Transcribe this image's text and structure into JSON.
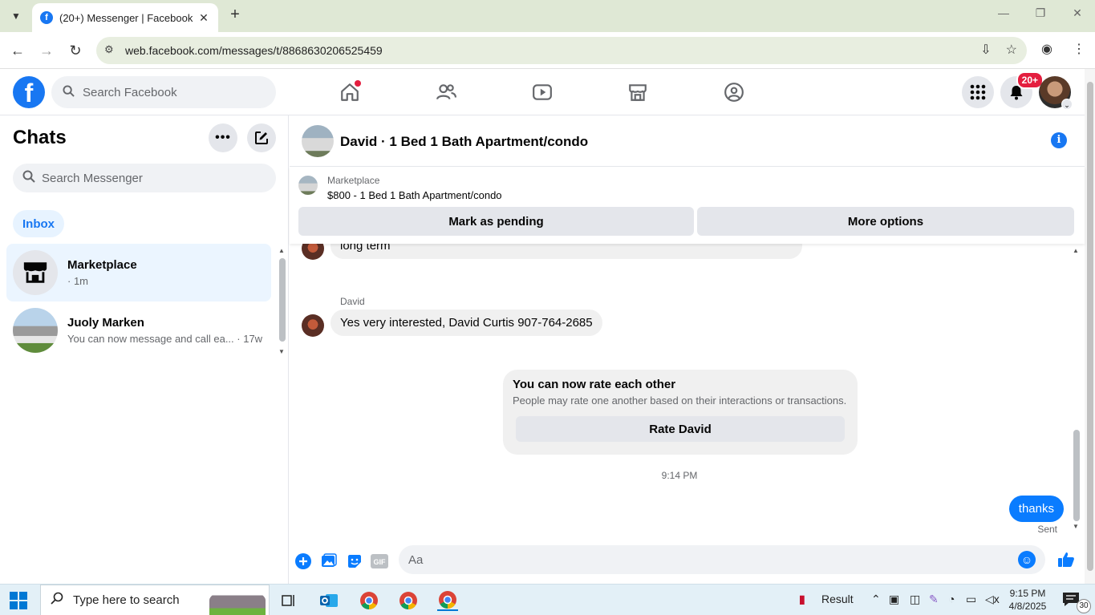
{
  "browser": {
    "tab_title": "(20+) Messenger | Facebook",
    "url": "web.facebook.com/messages/t/8868630206525459"
  },
  "fb_nav": {
    "search_placeholder": "Search Facebook",
    "notification_badge": "20+"
  },
  "chats": {
    "title": "Chats",
    "search_placeholder": "Search Messenger",
    "filter": "Inbox",
    "items": [
      {
        "name": "Marketplace",
        "preview": "· 1m"
      },
      {
        "name": "Juoly Marken",
        "preview": "You can now message and call ea... · 17w"
      }
    ]
  },
  "conversation": {
    "title": "David · 1 Bed 1 Bath Apartment/condo",
    "marketplace_label": "Marketplace",
    "listing": "$800 - 1 Bed 1 Bath Apartment/condo",
    "mark_pending": "Mark as pending",
    "more_options": "More options",
    "messages": {
      "prev_partial": "long term",
      "sender": "David",
      "incoming": "Yes very interested, David Curtis 907-764-2685",
      "rate_title": "You can now rate each other",
      "rate_sub": "People may rate one another based on their interactions or transactions.",
      "rate_button": "Rate David",
      "time": "9:14 PM",
      "outgoing": "thanks",
      "status": "Sent"
    },
    "composer_placeholder": "Aa"
  },
  "taskbar": {
    "search_text": "Type here to search",
    "result_label": "Result",
    "time": "9:15 PM",
    "date": "4/8/2025",
    "notification_count": "30"
  },
  "colors": {
    "brand": "#1877f2",
    "outgoing_bubble": "#0a7cff",
    "active_chat": "#ebf5ff"
  }
}
